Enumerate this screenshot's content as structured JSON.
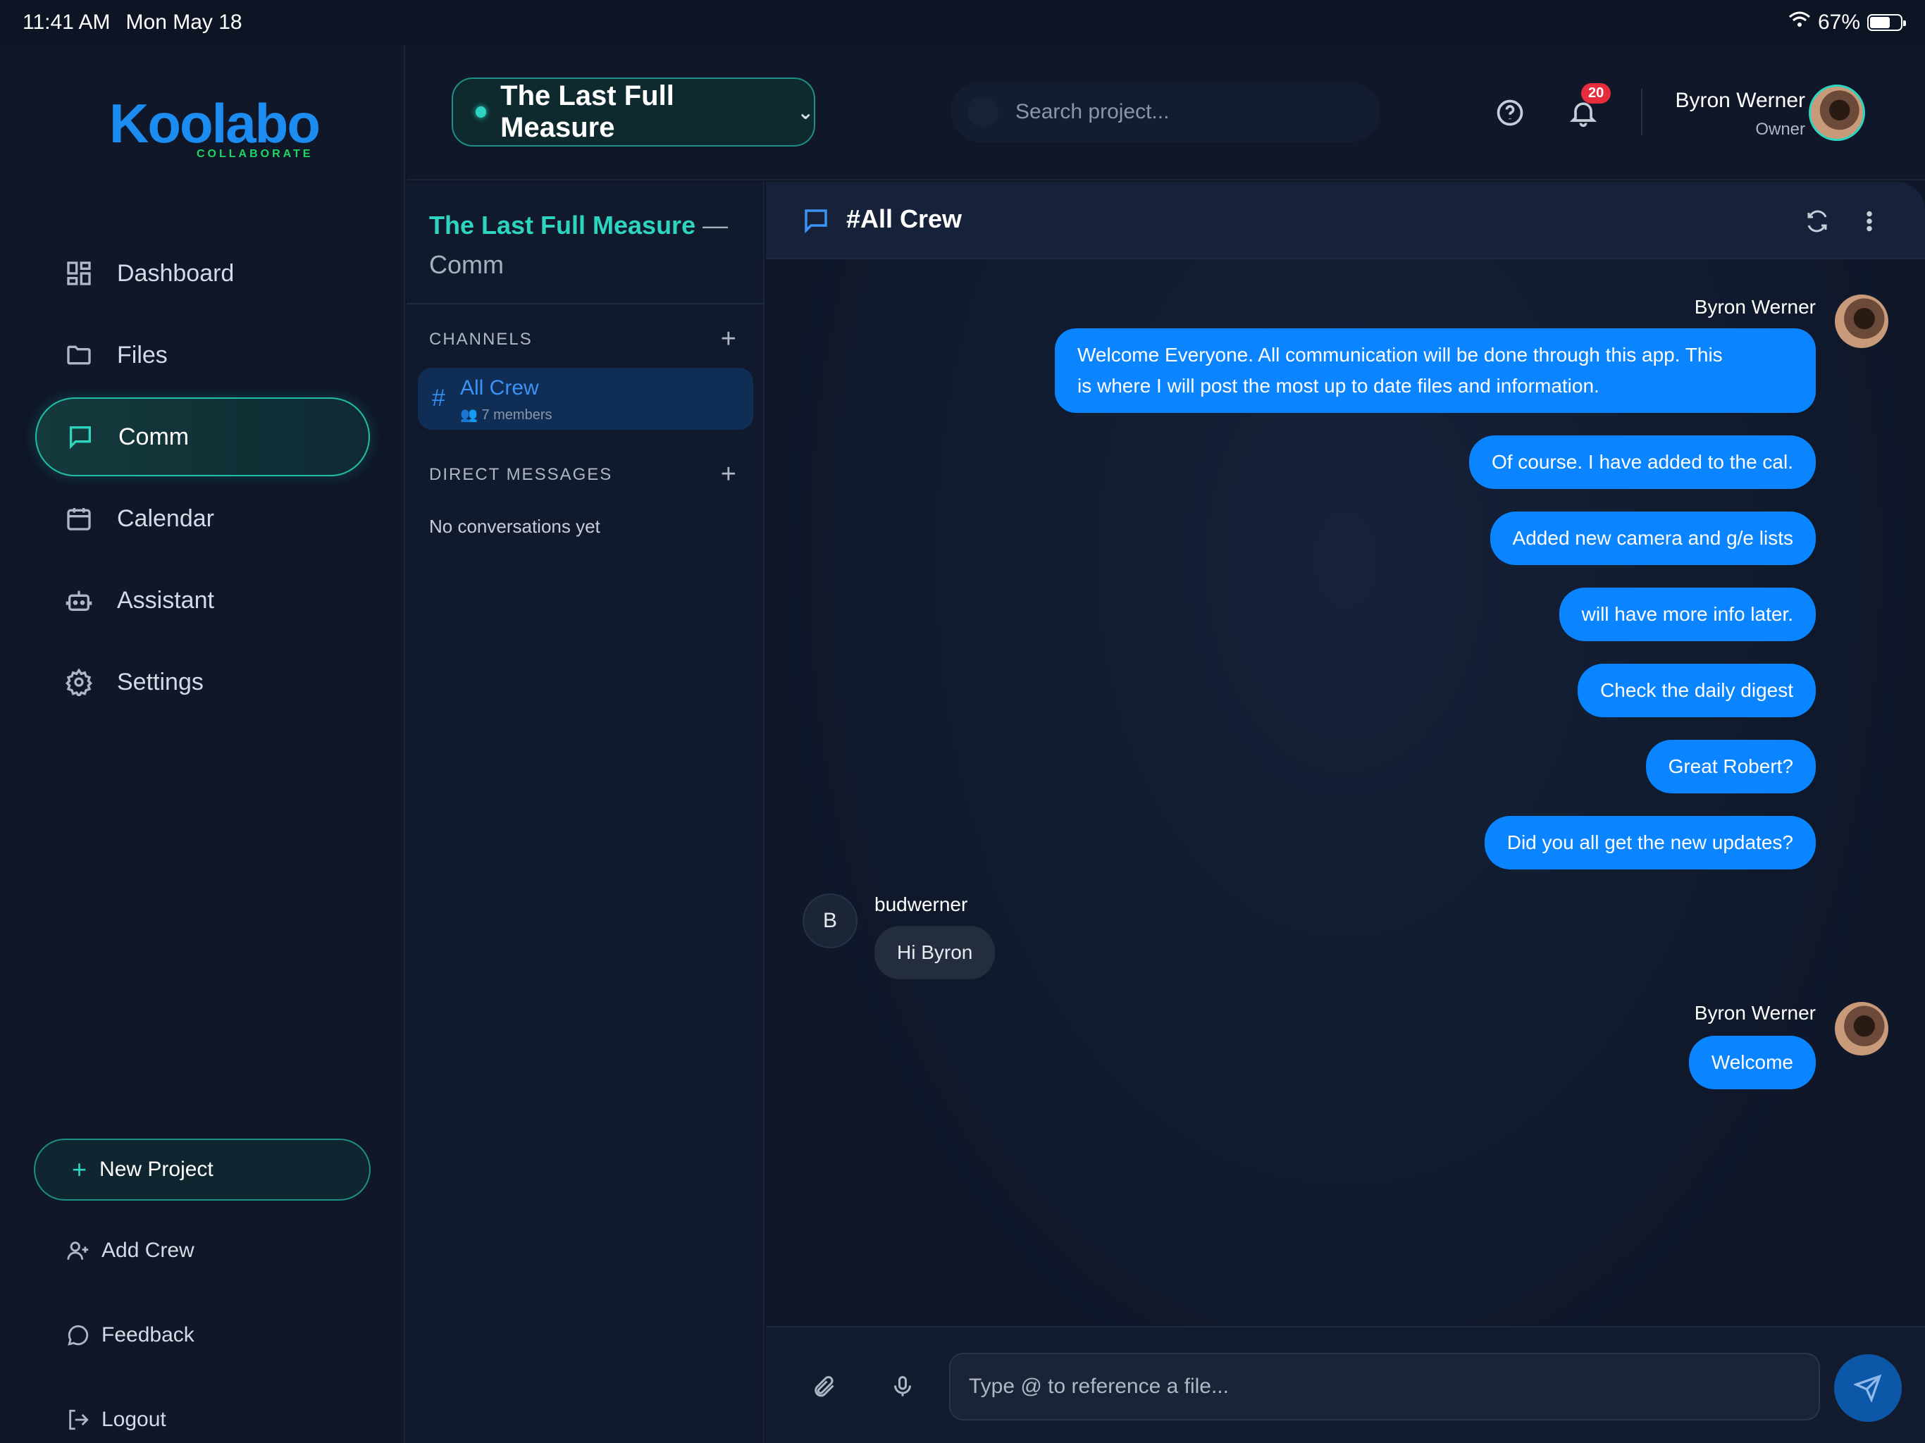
{
  "status": {
    "time": "11:41 AM",
    "date": "Mon May 18",
    "battery": "67%",
    "battery_level": 0.67
  },
  "brand": {
    "name": "Koolabo",
    "tagline": "COLLABORATE"
  },
  "nav": {
    "items": [
      {
        "label": "Dashboard",
        "icon": "dashboard-icon"
      },
      {
        "label": "Files",
        "icon": "folder-icon"
      },
      {
        "label": "Comm",
        "icon": "chat-icon",
        "active": true
      },
      {
        "label": "Calendar",
        "icon": "calendar-icon"
      },
      {
        "label": "Assistant",
        "icon": "robot-icon"
      },
      {
        "label": "Settings",
        "icon": "gear-icon"
      }
    ],
    "new_project": "New Project",
    "add_crew": "Add Crew",
    "feedback": "Feedback",
    "logout": "Logout"
  },
  "header": {
    "project": "The Last Full Measure",
    "search_placeholder": "Search project...",
    "notifications": "20",
    "user_name": "Byron Werner",
    "user_role": "Owner"
  },
  "channels_panel": {
    "title_project": "The Last Full Measure",
    "title_rest": " — Comm",
    "channels_label": "CHANNELS",
    "channels": [
      {
        "name": "All Crew",
        "members": "7 members"
      }
    ],
    "dm_label": "DIRECT MESSAGES",
    "dm_empty": "No conversations yet"
  },
  "chat": {
    "title": "#All Crew",
    "messages": [
      {
        "author": "Byron Werner",
        "text_line1": "Welcome Everyone.  All communication will be done through this app.  This",
        "text_line2": "is where I will post the most up to date files and information."
      },
      {
        "text": "Of course. I have added to the cal."
      },
      {
        "text": "Added new camera and g/e lists"
      },
      {
        "text": "will have more info later."
      },
      {
        "text": "Check the daily digest"
      },
      {
        "text": "Great Robert?"
      },
      {
        "text": "Did you all get the new updates?"
      },
      {
        "author": "budwerner",
        "initial": "B",
        "text": "Hi Byron"
      },
      {
        "author": "Byron Werner",
        "text": "Welcome"
      }
    ],
    "composer_placeholder": "Type @ to reference a file..."
  }
}
